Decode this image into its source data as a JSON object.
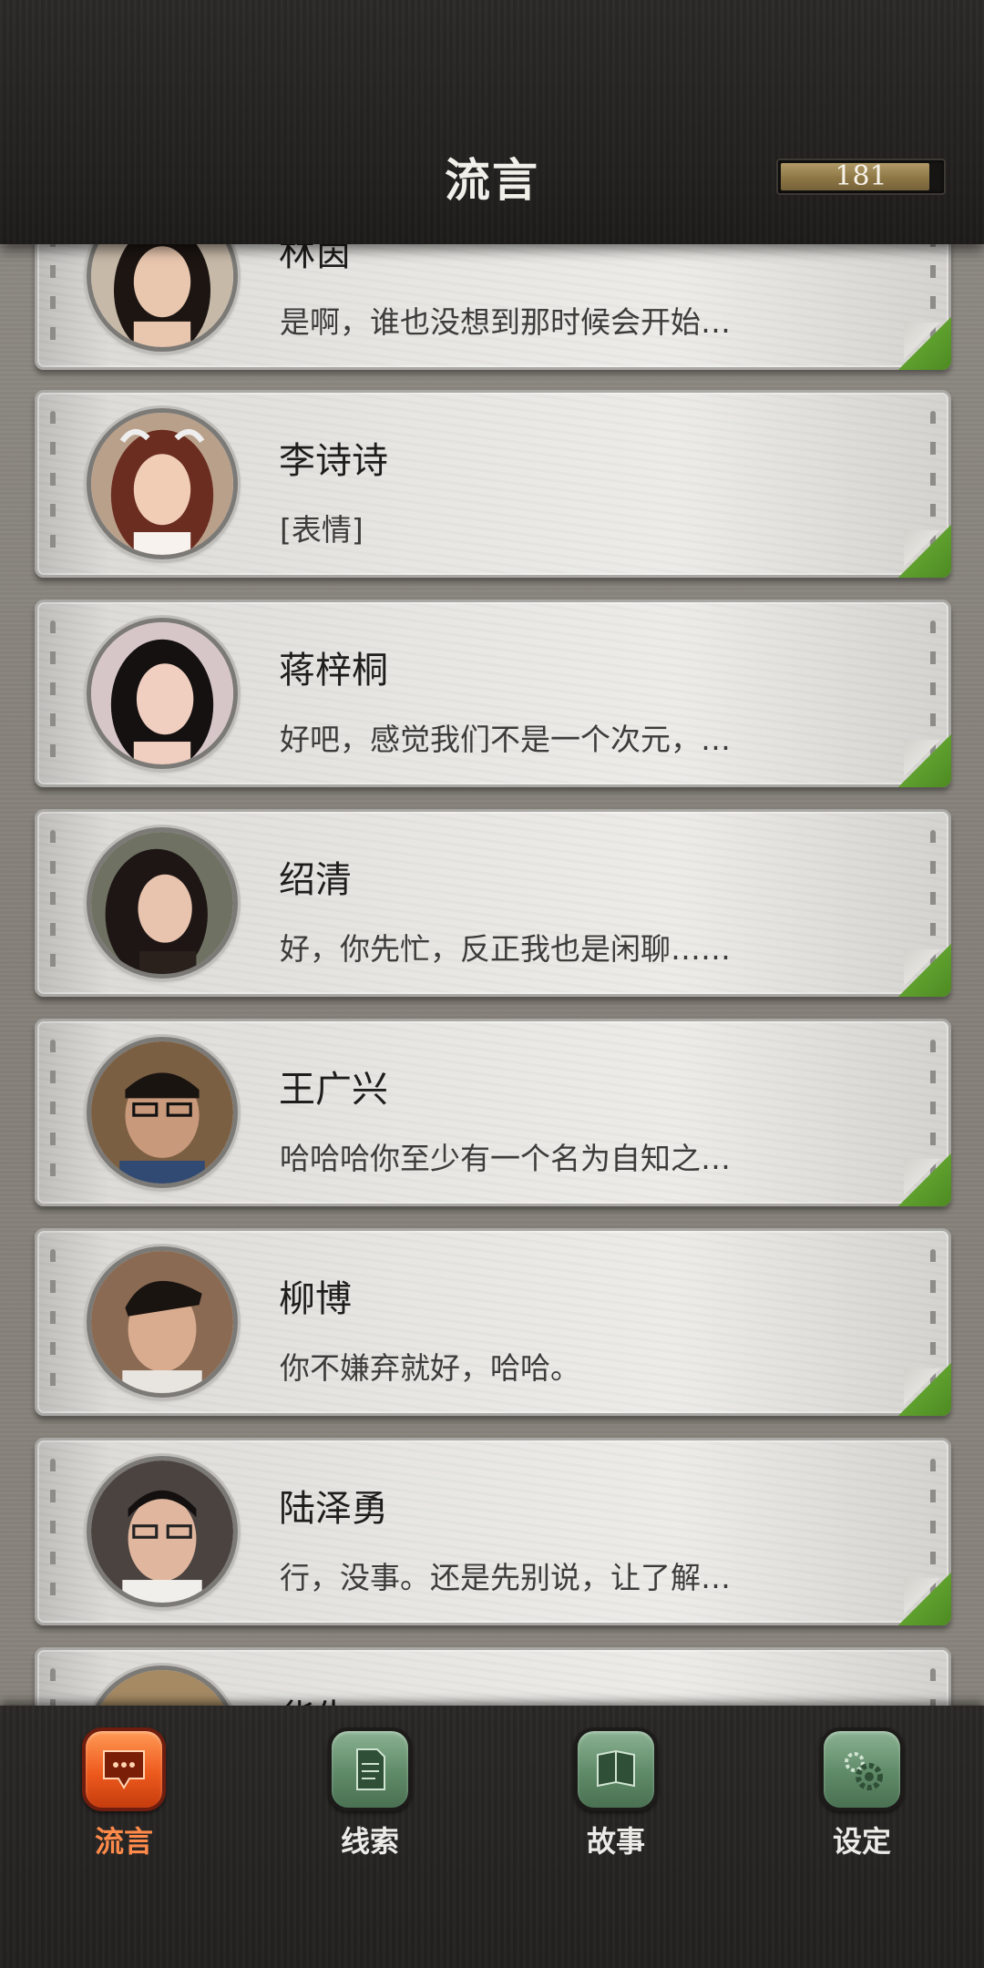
{
  "header": {
    "title": "流言",
    "currency_value": "181"
  },
  "conversations": [
    {
      "name": "林茵",
      "preview": "是啊，谁也没想到那时候会开始…"
    },
    {
      "name": "李诗诗",
      "preview": "[表情]"
    },
    {
      "name": "蒋梓桐",
      "preview": "好吧，感觉我们不是一个次元，…"
    },
    {
      "name": "绍清",
      "preview": "好，你先忙，反正我也是闲聊……"
    },
    {
      "name": "王广兴",
      "preview": "哈哈哈你至少有一个名为自知之…"
    },
    {
      "name": "柳博",
      "preview": "你不嫌弃就好，哈哈。"
    },
    {
      "name": "陆泽勇",
      "preview": "行，没事。还是先别说，让了解…"
    },
    {
      "name": "华生",
      "preview": ""
    }
  ],
  "bottom_nav": {
    "items": [
      {
        "label": "流言",
        "icon": "chat-bubble-icon",
        "active": true
      },
      {
        "label": "线索",
        "icon": "document-icon",
        "active": false
      },
      {
        "label": "故事",
        "icon": "book-icon",
        "active": false
      },
      {
        "label": "设定",
        "icon": "gear-icon",
        "active": false
      }
    ]
  },
  "colors": {
    "active_tab": "#ee5a1e",
    "inactive_tab": "#5f8a68",
    "page_curl": "#5fa02e"
  }
}
